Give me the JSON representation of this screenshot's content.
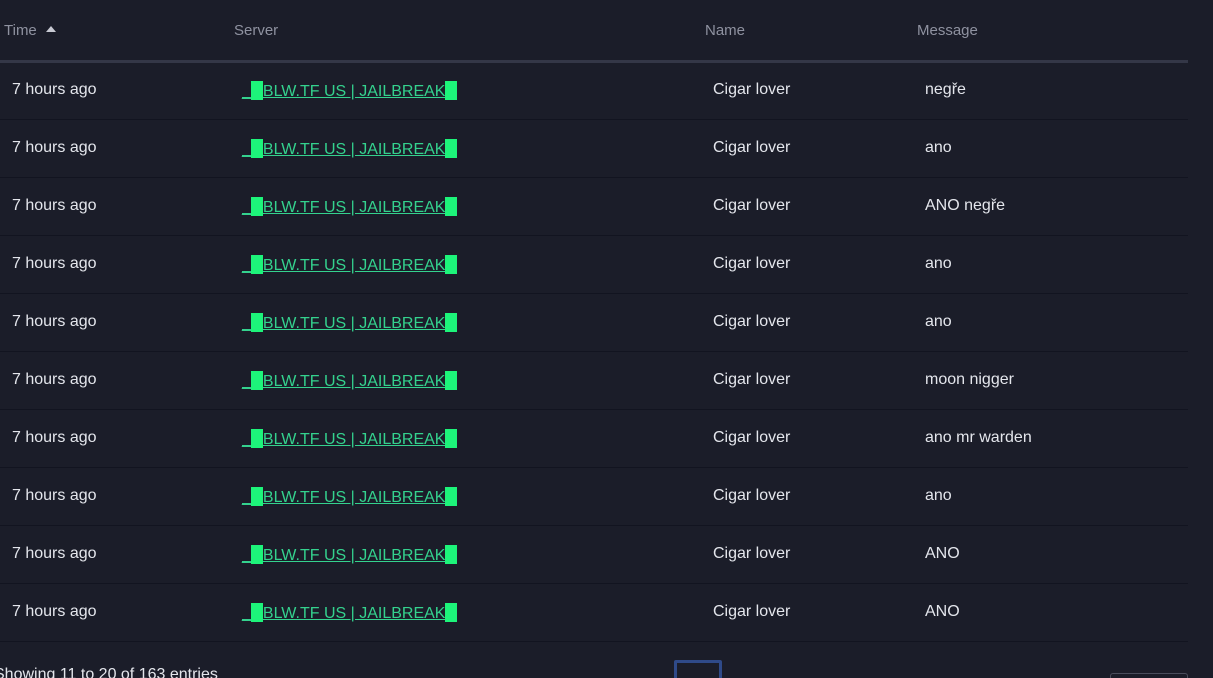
{
  "table": {
    "columns": {
      "time": "Time",
      "server": "Server",
      "name": "Name",
      "message": "Message"
    },
    "rows": [
      {
        "time": "7 hours ago",
        "server": "BLW.TF US | JAILBREAK",
        "name": "Cigar lover",
        "message": "negře"
      },
      {
        "time": "7 hours ago",
        "server": "BLW.TF US | JAILBREAK",
        "name": "Cigar lover",
        "message": "ano"
      },
      {
        "time": "7 hours ago",
        "server": "BLW.TF US | JAILBREAK",
        "name": "Cigar lover",
        "message": "ANO negře"
      },
      {
        "time": "7 hours ago",
        "server": "BLW.TF US | JAILBREAK",
        "name": "Cigar lover",
        "message": "ano"
      },
      {
        "time": "7 hours ago",
        "server": "BLW.TF US | JAILBREAK",
        "name": "Cigar lover",
        "message": "ano"
      },
      {
        "time": "7 hours ago",
        "server": "BLW.TF US | JAILBREAK",
        "name": "Cigar lover",
        "message": "moon nigger"
      },
      {
        "time": "7 hours ago",
        "server": "BLW.TF US | JAILBREAK",
        "name": "Cigar lover",
        "message": "ano mr warden"
      },
      {
        "time": "7 hours ago",
        "server": "BLW.TF US | JAILBREAK",
        "name": "Cigar lover",
        "message": "ano"
      },
      {
        "time": "7 hours ago",
        "server": "BLW.TF US | JAILBREAK",
        "name": "Cigar lover",
        "message": "ANO"
      },
      {
        "time": "7 hours ago",
        "server": "BLW.TF US | JAILBREAK",
        "name": "Cigar lover",
        "message": "ANO"
      }
    ]
  },
  "footer": {
    "info": "Showing 11 to 20 of 163 entries"
  },
  "colors": {
    "background": "#1b1d29",
    "link": "#34d28e",
    "accent_block": "#1df47a"
  }
}
